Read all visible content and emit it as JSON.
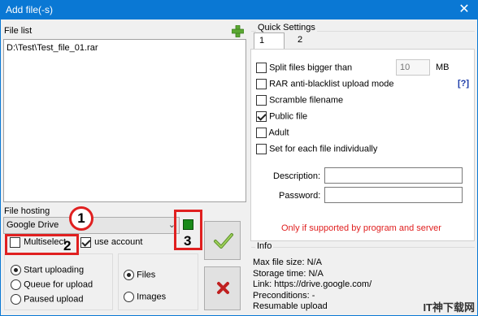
{
  "window": {
    "title": "Add file(-s)",
    "close_glyph": "✕"
  },
  "file_list": {
    "label": "File list",
    "files": [
      "D:\\Test\\Test_file_01.rar"
    ]
  },
  "file_hosting": {
    "label": "File hosting",
    "selected": "Google Drive",
    "multiselect_label": "Multiselect",
    "multiselect_checked": false,
    "use_account_label": "use account",
    "use_account_checked": true
  },
  "upload_mode": {
    "options": [
      "Start uploading",
      "Queue for upload",
      "Paused upload"
    ],
    "selected": "Start uploading"
  },
  "media_type": {
    "options": [
      "Files",
      "Images"
    ],
    "selected": "Files"
  },
  "callouts": [
    "1",
    "2",
    "3"
  ],
  "status_indicator_color": "#1a8a1a",
  "quick_settings": {
    "label": "Quick Settings",
    "tabs": [
      "1",
      "2"
    ],
    "active_tab": "1",
    "split_label": "Split files bigger than",
    "split_value": "10",
    "split_unit": "MB",
    "split_checked": false,
    "rar_label": "RAR anti-blacklist upload mode",
    "rar_checked": false,
    "help_link": "[?]",
    "scramble_label": "Scramble filename",
    "scramble_checked": false,
    "public_label": "Public file",
    "public_checked": true,
    "adult_label": "Adult",
    "adult_checked": false,
    "each_label": "Set for each file individually",
    "each_checked": false,
    "description_label": "Description:",
    "description_value": "",
    "password_label": "Password:",
    "password_value": "",
    "note": "Only if supported by program and server",
    "note_color": "#e02020"
  },
  "info": {
    "label": "Info",
    "lines": [
      "Max file size: N/A",
      "Storage time: N/A",
      "Link: https://drive.google.com/",
      "Preconditions: -",
      "Resumable upload"
    ]
  },
  "watermark": "IT神下载网"
}
